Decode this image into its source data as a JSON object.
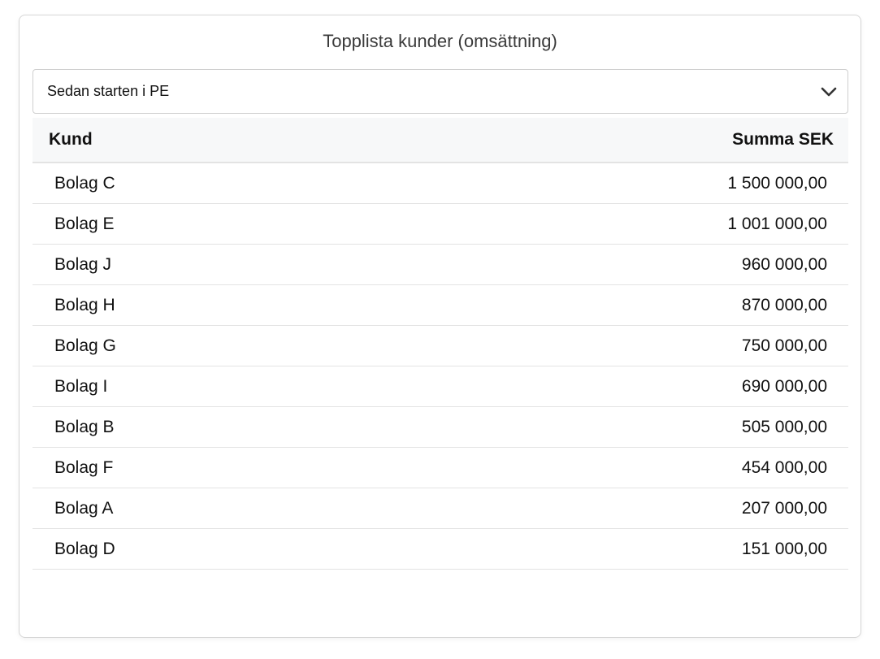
{
  "card": {
    "title": "Topplista kunder (omsättning)"
  },
  "period_select": {
    "value": "Sedan starten i PE",
    "icon": "chevron-down-icon"
  },
  "table": {
    "columns": [
      "Kund",
      "Summa SEK"
    ],
    "rows": [
      {
        "kund": "Bolag C",
        "summa": "1 500 000,00"
      },
      {
        "kund": "Bolag E",
        "summa": "1 001 000,00"
      },
      {
        "kund": "Bolag J",
        "summa": "960 000,00"
      },
      {
        "kund": "Bolag H",
        "summa": "870 000,00"
      },
      {
        "kund": "Bolag G",
        "summa": "750 000,00"
      },
      {
        "kund": "Bolag I",
        "summa": "690 000,00"
      },
      {
        "kund": "Bolag B",
        "summa": "505 000,00"
      },
      {
        "kund": "Bolag F",
        "summa": "454 000,00"
      },
      {
        "kund": "Bolag A",
        "summa": "207 000,00"
      },
      {
        "kund": "Bolag D",
        "summa": "151 000,00"
      }
    ]
  }
}
